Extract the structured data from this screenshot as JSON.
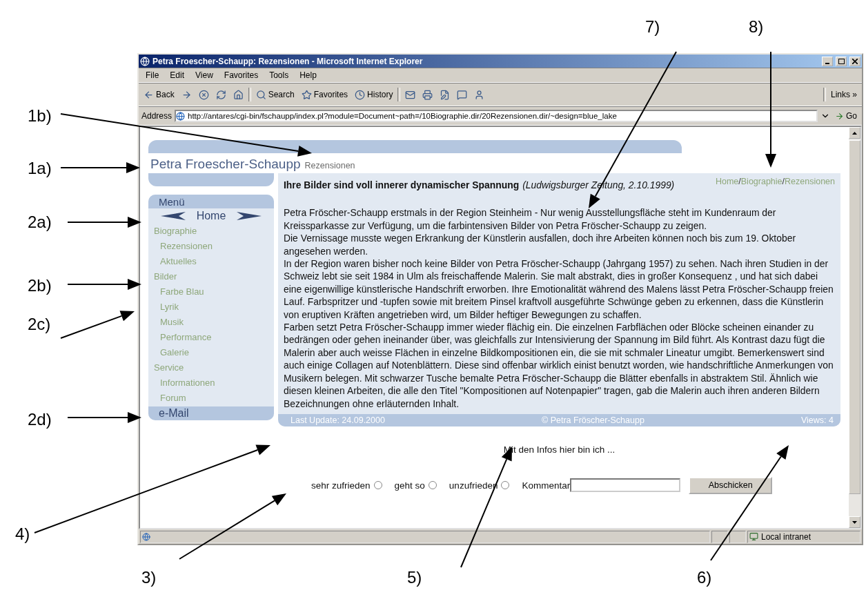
{
  "annotations": [
    {
      "label": "1b)"
    },
    {
      "label": "1a)"
    },
    {
      "label": "2a)"
    },
    {
      "label": "2b)"
    },
    {
      "label": "2c)"
    },
    {
      "label": "2d)"
    },
    {
      "label": "4)"
    },
    {
      "label": "3)"
    },
    {
      "label": "5)"
    },
    {
      "label": "6)"
    },
    {
      "label": "7)"
    },
    {
      "label": "8)"
    }
  ],
  "window": {
    "title": "Petra Froescher-Schaupp: Rezensionen - Microsoft Internet Explorer"
  },
  "menu_bar": [
    "File",
    "Edit",
    "View",
    "Favorites",
    "Tools",
    "Help"
  ],
  "toolbar": [
    {
      "kind": "back",
      "label": "Back"
    },
    {
      "kind": "forward"
    },
    {
      "kind": "stop"
    },
    {
      "kind": "refresh"
    },
    {
      "kind": "home"
    },
    {
      "kind": "search",
      "label": "Search"
    },
    {
      "kind": "favorites",
      "label": "Favorites"
    },
    {
      "kind": "history",
      "label": "History"
    },
    {
      "kind": "mail"
    },
    {
      "kind": "print"
    },
    {
      "kind": "edit"
    },
    {
      "kind": "discuss"
    },
    {
      "kind": "messenger"
    }
  ],
  "links": "Links »",
  "address": {
    "label": "Address",
    "value": "http://antares/cgi-bin/fschaupp/index.pl?module=Document~path=/10Biographie.dir/20Rezensionen.dir/~design=blue_lake",
    "go": "Go"
  },
  "page": {
    "site_title": "Petra Froescher-Schaupp",
    "section": "Rezensionen",
    "breadcrumb": {
      "separator": "/",
      "items": [
        "Home",
        "Biographie",
        "Rezensionen"
      ]
    },
    "menu": {
      "title": "Menü",
      "nav": "Home",
      "footer": "e-Mail",
      "items": [
        {
          "label": "Biographie",
          "children": [
            {
              "label": "Rezensionen"
            },
            {
              "label": "Aktuelles"
            }
          ]
        },
        {
          "label": "Bilder",
          "children": [
            {
              "label": "Farbe Blau"
            },
            {
              "label": "Lyrik"
            },
            {
              "label": "Musik"
            },
            {
              "label": "Performance"
            },
            {
              "label": "Galerie"
            }
          ]
        },
        {
          "label": "Service",
          "children": [
            {
              "label": "Informationen"
            },
            {
              "label": "Forum"
            }
          ]
        }
      ]
    },
    "article": {
      "headline": "Ihre Bilder sind voll innerer dynamischer Spannung",
      "source": "(Ludwigsburger Zeitung, 2.10.1999)",
      "paragraphs": [
        "Petra Fröscher-Schaupp erstmals in der Region Steinheim - Nur wenig Ausstellungsfläche steht im Kundenraum der Kreissparkasse zur Verfügung, um die farbintensiven Bilder von Petra Fröscher-Schaupp zu zeigen.",
        "Die Vernissage musste wegen Erkrankung der Künstlerin ausfallen, doch ihre Arbeiten können noch bis zum 19. Oktober angesehen werden.",
        "In der Region waren bisher noch keine Bilder von Petra Fröscher-Schaupp (Jahrgang 1957) zu sehen. Nach ihren Studien in der Schweiz lebt sie seit 1984 in Ulm als freischaffende Malerin. Sie malt abstrakt, dies in großer Konsequenz , und hat sich dabei eine eigenwillige künstlerische Handschrift erworben. Ihre Emotionalität während des Malens lässt Petra Fröscher-Schaupp freien Lauf. Farbspritzer und -tupfen sowie mit breitem Pinsel kraftvoll ausgeführte Schwünge geben zu erkennen, dass die Künstlerin von eruptiven Kräften angetrieben wird, um Bilder heftiger Bewegungen zu schaffen.",
        "Farben setzt Petra Fröscher-Schaupp immer wieder flächig ein. Die einzelnen Farbflächen oder Blöcke scheinen einander zu bedrängen oder gehen ineinander über, was gleichfalls zur Intensivierung der Spannung im Bild führt. Als Kontrast dazu fügt die Malerin aber auch weisse Flächen in einzelne Bildkompositionen ein, die sie mit schmaler Lineatur umgibt. Bemerkenswert sind auch einige Collagen auf Notenblättern. Diese sind offenbar wirklich einist benutzt worden, wie handschriftliche Anmerkungen von Musikern belegen. Mit schwarzer Tusche bemalte Petra Fröscher-Schaupp die Blätter ebenfalls in abstraktem Stil. Ähnlich wie diesen kleinen Arbeiten, die alle den Titel \"Kompositionen auf Notenpapier\" tragen, gab die Malerin auch ihren anderen Bildern Bezeichnungen ohne erläuternden Inhalt."
      ]
    },
    "footer": {
      "updated": "Last Update: 24.09.2000",
      "copyright": "© Petra Fröscher-Schaupp",
      "views": "Views: 4"
    },
    "feedback": {
      "prompt": "Mit den Infos hier bin ich ...",
      "options": [
        {
          "label": "sehr zufrieden",
          "selected": false
        },
        {
          "label": "geht so",
          "selected": false
        },
        {
          "label": "unzufrieden",
          "selected": false
        }
      ],
      "comment_label": "Kommentar",
      "submit": "Abschicken"
    }
  },
  "status_bar": {
    "zone": "Local intranet"
  }
}
